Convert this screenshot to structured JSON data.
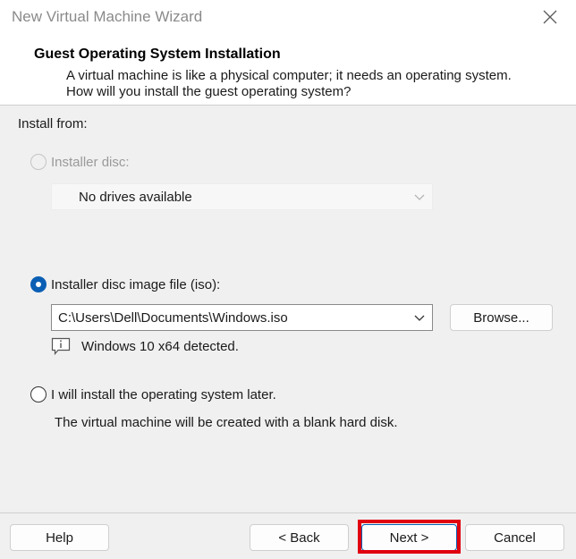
{
  "window": {
    "title": "New Virtual Machine Wizard",
    "close_icon": "close-icon"
  },
  "header": {
    "title": "Guest Operating System Installation",
    "description": "A virtual machine is like a physical computer; it needs an operating system. How will you install the guest operating system?"
  },
  "install_from": {
    "label": "Install from:",
    "options": [
      {
        "label": "Installer disc:",
        "selected": false,
        "enabled": false,
        "dropdown_value": "No drives available"
      },
      {
        "label": "Installer disc image file (iso):",
        "selected": true,
        "enabled": true,
        "path_value": "C:\\Users\\Dell\\Documents\\Windows.iso",
        "browse_label": "Browse...",
        "detected_icon": "info-icon",
        "detected_message": "Windows 10 x64 detected."
      },
      {
        "label": "I will install the operating system later.",
        "selected": false,
        "enabled": true,
        "note": "The virtual machine will be created with a blank hard disk."
      }
    ]
  },
  "footer": {
    "help_label": "Help",
    "back_label": "< Back",
    "next_label": "Next >",
    "cancel_label": "Cancel"
  },
  "colors": {
    "accent": "#0a5fb4",
    "highlight": "#e0000f"
  }
}
